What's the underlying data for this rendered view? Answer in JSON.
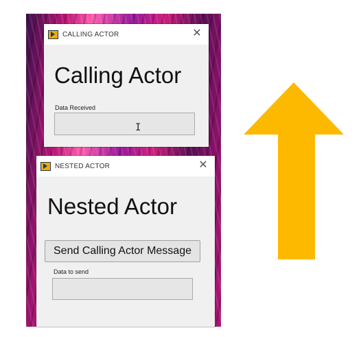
{
  "calling_window": {
    "title": "CALLING ACTOR",
    "close_glyph": "✕",
    "heading": "Calling Actor",
    "field_label": "Data Received",
    "field_value": ""
  },
  "nested_window": {
    "title": "NESTED ACTOR",
    "close_glyph": "✕",
    "heading": "Nested Actor",
    "send_button": "Send Calling Actor Message",
    "field_label": "Data to send",
    "field_value": ""
  },
  "colors": {
    "arrow": "#fdb900",
    "window_bg": "#f0f0f0",
    "app_icon": "#f2a900"
  },
  "icons": [
    "labview-app-icon",
    "close-icon",
    "text-cursor-icon",
    "up-arrow-icon"
  ]
}
